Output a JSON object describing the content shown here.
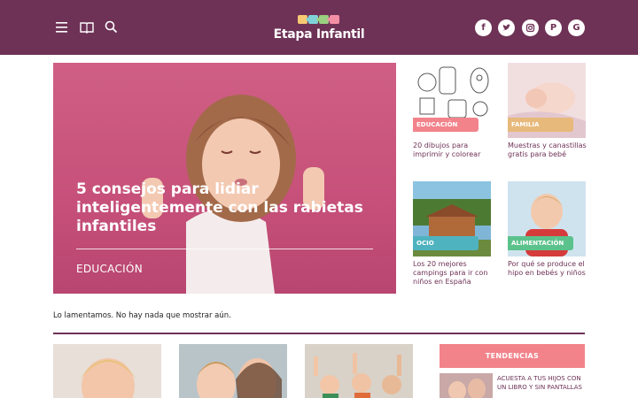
{
  "header": {
    "brand": "Etapa Infantil",
    "icons": [
      "menu-icon",
      "book-icon",
      "search-icon"
    ],
    "social": [
      "facebook-icon",
      "twitter-icon",
      "instagram-icon",
      "pinterest-icon",
      "google-icon"
    ],
    "colors": {
      "brand": "#6e3256",
      "white": "#ffffff"
    }
  },
  "hero": {
    "title": "5 consejos para lidiar inteligentemente con las rabietas infantiles",
    "category": "EDUCACIÓN"
  },
  "cards": [
    {
      "badge": "EDUCACIÓN",
      "title": "20 dibujos para imprimir y colorear",
      "badge_color": "#f2838b"
    },
    {
      "badge": "FAMILIA",
      "title": "Muestras y canastillas gratis para bebé",
      "badge_color": "#e7b97a"
    },
    {
      "badge": "OCIO",
      "title": "Los 20 mejores campings para ir con niños en España",
      "badge_color": "#4fb3bf"
    },
    {
      "badge": "ALIMENTACIÓN",
      "title": "Por qué se produce el hipo en bebés y niños",
      "badge_color": "#5cc28c"
    }
  ],
  "main": {
    "empty_message": "Lo lamentamos. No hay nada que mostrar aún."
  },
  "sidebar": {
    "trending_label": "TENDENCIAS",
    "trending_item": "ACUESTA A TUS HIJOS CON UN LIBRO Y SIN PANTALLAS"
  }
}
